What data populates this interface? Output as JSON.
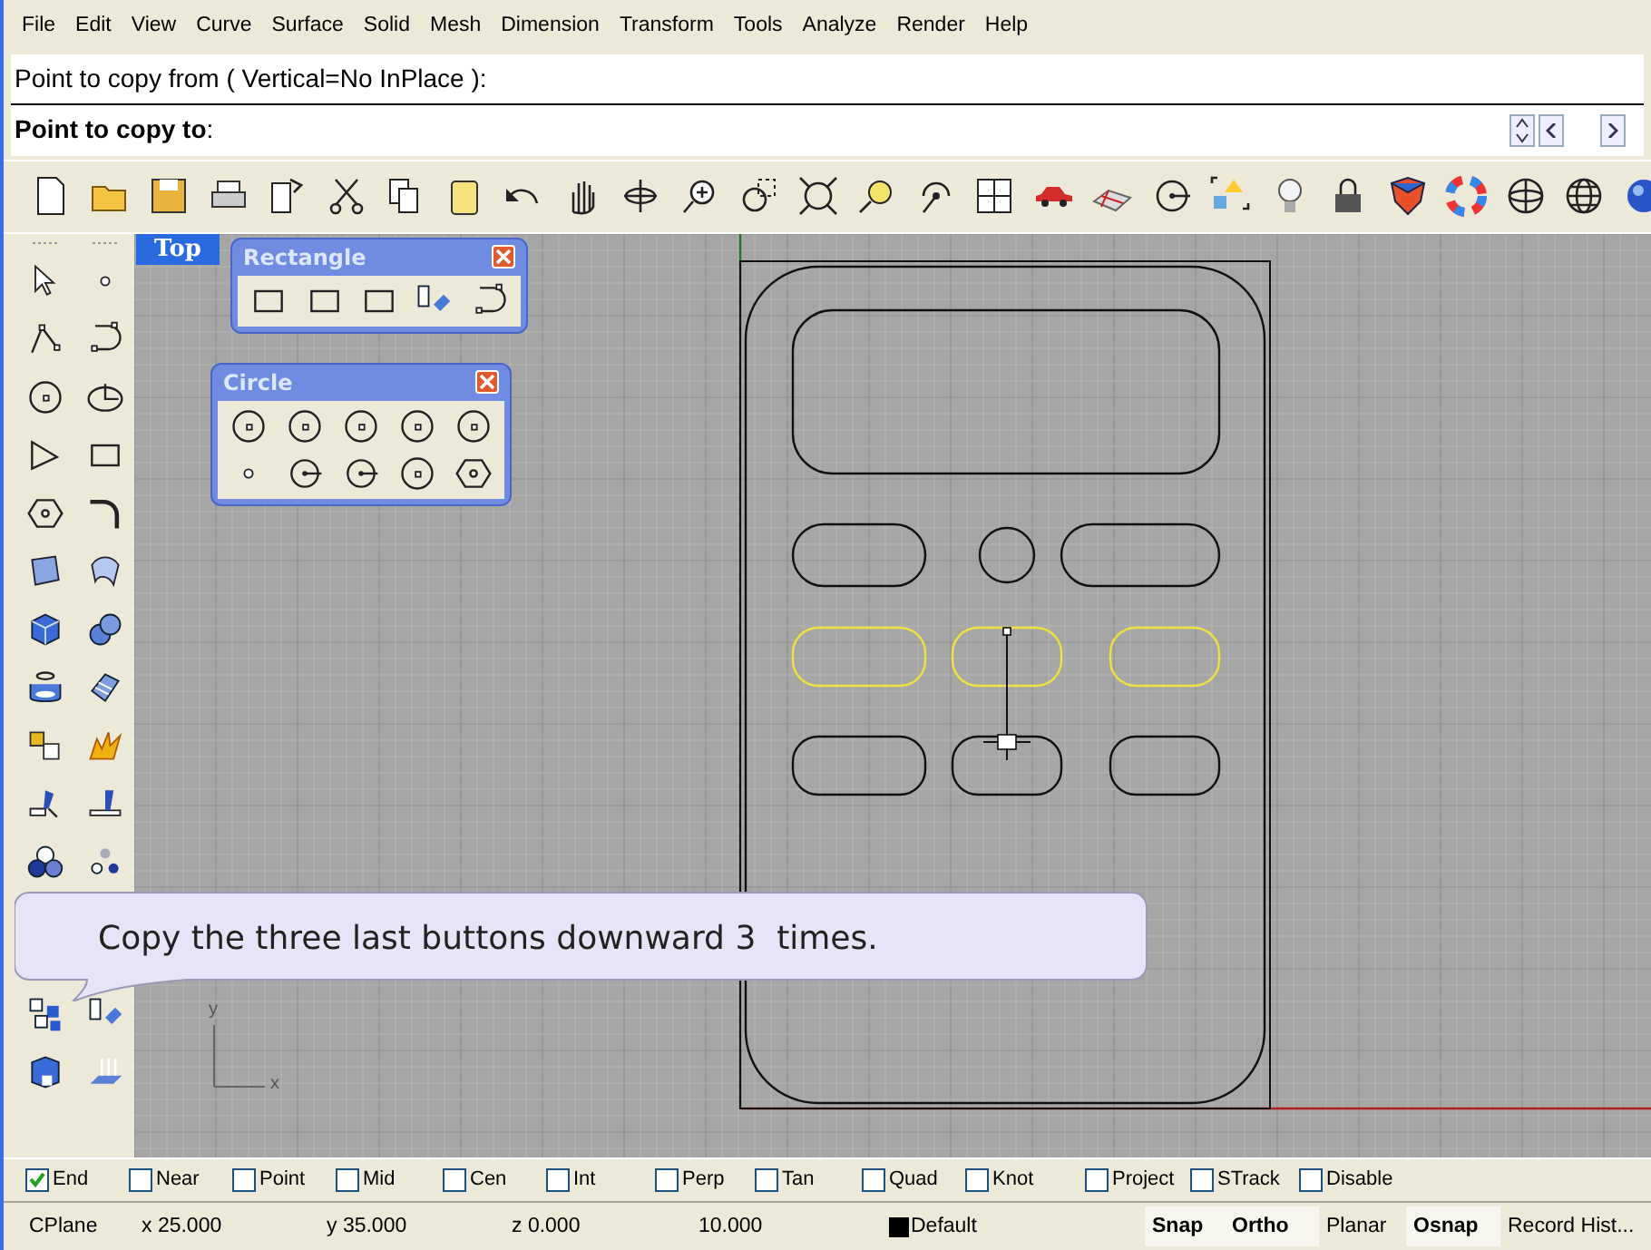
{
  "menu": [
    "File",
    "Edit",
    "View",
    "Curve",
    "Surface",
    "Solid",
    "Mesh",
    "Dimension",
    "Transform",
    "Tools",
    "Analyze",
    "Render",
    "Help"
  ],
  "command": {
    "history": "Point to copy from ( Vertical=No  InPlace ):",
    "prompt": "**Point to copy to**:"
  },
  "viewport": {
    "label": "Top",
    "panels": [
      {
        "title": "Rectangle",
        "kind": "rectangle"
      },
      {
        "title": "Circle",
        "kind": "circle"
      }
    ],
    "button_rows": [
      {
        "kind": "mixed",
        "selected": false
      },
      {
        "kind": "pills",
        "selected": true
      },
      {
        "kind": "pills",
        "selected": false
      }
    ],
    "axis_labels": [
      "y",
      "x"
    ],
    "callout": "Copy the three last buttons downward 3  times."
  },
  "osnaps": [
    {
      "label": "End",
      "checked": true
    },
    {
      "label": "Near",
      "checked": false
    },
    {
      "label": "Point",
      "checked": false
    },
    {
      "label": "Mid",
      "checked": false
    },
    {
      "label": "Cen",
      "checked": false
    },
    {
      "label": "Int",
      "checked": false
    },
    {
      "label": "Perp",
      "checked": false
    },
    {
      "label": "Tan",
      "checked": false
    },
    {
      "label": "Quad",
      "checked": false
    },
    {
      "label": "Knot",
      "checked": false
    },
    {
      "label": "Project",
      "checked": false
    },
    {
      "label": "STrack",
      "checked": false
    },
    {
      "label": "Disable",
      "checked": false
    }
  ],
  "status": {
    "cplane": "CPlane",
    "x": "x 25.000",
    "y": "y 35.000",
    "z": "z 0.000",
    "distance": "10.000",
    "layer": "Default",
    "toggles": [
      {
        "label": "Snap",
        "on": true
      },
      {
        "label": "Ortho",
        "on": true
      },
      {
        "label": "Planar",
        "on": false
      },
      {
        "label": "Osnap",
        "on": true
      },
      {
        "label": "Record Hist...",
        "on": false
      }
    ]
  }
}
